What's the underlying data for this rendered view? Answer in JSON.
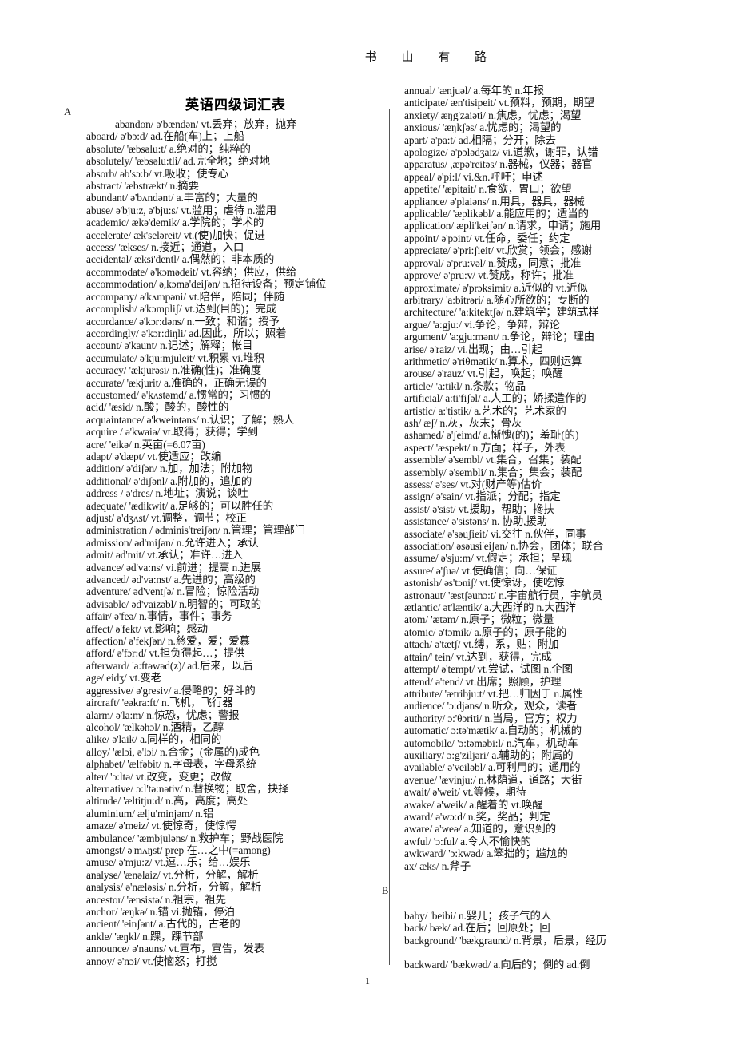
{
  "header": {
    "running_head": "书 山 有 路"
  },
  "title": "英语四级词汇表",
  "footer": {
    "page_number": "1"
  },
  "left_column": {
    "section_letter": "A",
    "entries": [
      "abandon/ ə'bændən/ vt.丢弃；放弃，抛弃",
      "aboard/ ə'bɔ:d/ ad.在船(车)上；上船",
      "absolute/ 'æbsəlu:t/ a.绝对的；纯粹的",
      "absolutely/ 'æbsəlu:tli/ ad.完全地；绝对地",
      "absorb/ əb'sɔ:b/ vt.吸收；使专心",
      "abstract/ 'æbstrækt/ n.摘要",
      "abundant/ ə'bʌndənt/ a.丰富的；大量的",
      "abuse/ ə'bju:z, ə'bju:s/ vt.滥用；虐待 n.滥用",
      "academic/ ækə'demik/ a.学院的；学术的",
      "accelerate/ æk'seləreit/ vt.(使)加快；促进",
      "access/ 'ækses/ n.接近；通道，入口",
      "accidental/ æksi'dentl/ a.偶然的；非本质的",
      "accommodate/ ə'kɔmədeit/ vt.容纳；供应，供给",
      "accommodation/ ə,kɔmə'deiʃən/ n.招待设备；预定铺位",
      "accompany/ ə'kʌmpəni/ vt.陪伴，陪同；伴随",
      "accomplish/ ə'kɔmpliʃ/ vt.达到(目的)；完成",
      "accordance/ ə'kɔr:dəns/ n.一致；和谐；授予",
      "accordingly/ ə'kɔr:diŋli/ ad.因此，所以；照着",
      "account/ ə'kaunt/ n.记述；解释；帐目",
      "accumulate/ ə'kju:mjuleit/ vt.积累 vi.堆积",
      "accuracy/ 'ækjurəsi/ n.准确(性)；准确度",
      "accurate/ 'ækjurit/ a.准确的，正确无误的",
      "accustomed/ ə'kʌstəmd/ a.惯常的；习惯的",
      "acid/ 'æsid/ n.酸；酸的，酸性的",
      "acquaintance/ ə'kweintəns/ n.认识；了解；熟人",
      "acquire / ə'kwaiə/ vt.取得；获得；学到",
      "acre/ 'eikə/ n.英亩(=6.07亩)",
      "adapt/ ə'dæpt/ vt.使适应；改编",
      "addition/ ə'diʃən/ n.加，加法；附加物",
      "additional/ ə'diʃənl/ a.附加的，追加的",
      "address / ə'dres/ n.地址；演说；谈吐",
      "adequate/ 'ædikwit/ a.足够的；可以胜任的",
      "adjust/ ə'dʒʌst/ vt.调整，调节；校正",
      "administration / ədminis'treiʃən/ n.管理；管理部门",
      "admission/ əd'miʃən/ n.允许进入；承认",
      "admit/ əd'mit/ vt.承认；准许…进入",
      "advance/ əd'va:ns/ vi.前进；提高 n.进展",
      "advanced/ əd'va:nst/ a.先进的；高级的",
      "adventure/ əd'ventʃə/ n.冒险；惊险活动",
      "advisable/ əd'vaizəbl/ n.明智的；可取的",
      "affair/ ə'feə/ n.事情，事件；事务",
      "affect/ ə'fekt/ vt.影响；感动",
      "affection/ ə'fekʃən/ n.慈爱，爱；爱慕",
      "afford/ ə'fɔr:d/ vt.担负得起…；提供",
      "afterward/ 'a:ftəwəd(z)/ ad.后来，以后",
      "age/ eidʒ/ vt.变老",
      "aggressive/ ə'gresiv/ a.侵略的；好斗的",
      "aircraft/ 'eəkra:ft/ n.飞机，飞行器",
      "alarm/ ə'la:m/ n.惊恐，忧虑；警报",
      "alcohol/ 'ælkəhɔl/ n.酒精，乙醇",
      "alike/ ə'laik/ a.同样的，相同的",
      "alloy/ 'ælɔi, ə'lɔi/ n.合金；(金属的)成色",
      "alphabet/ 'ælfəbit/ n.字母表，字母系统",
      "alter/ 'ɔ:ltə/ vt.改变，变更；改做",
      "alternative/ ɔ:l'tə:nətiv/ n.替换物；取舍，抉择",
      "altitude/ 'æltitju:d/ n.高，高度；高处",
      "aluminium/ ælju'minjəm/ n.铝",
      "amaze/ ə'meiz/ vt.使惊奇，使惊愕",
      "ambulance/ 'æmbjuləns/ n.救护车；野战医院",
      "amongst/ ə'mʌŋst/ prep 在…之中(=among)",
      "amuse/ ə'mju:z/ vt.逗…乐；给…娱乐",
      "analyse/ 'ænəlaiz/ vt.分析，分解，解析",
      "analysis/ ə'næləsis/ n.分析，分解，解析",
      "ancestor/ 'ænsistə/ n.祖宗，祖先",
      "anchor/ 'æŋkə/ n.锚 vi.抛锚，停泊",
      "ancient/ 'einʃənt/ a.古代的，古老的",
      "ankle/ 'æŋkl/ n.踝，踝节部",
      "announce/ ə'nauns/ vt.宣布，宣告，发表",
      "annoy/ ə'nɔi/ vt.使恼怒；打搅"
    ]
  },
  "right_column": {
    "entries": [
      "annual/ 'ænjuəl/ a.每年的 n.年报",
      "anticipate/ æn'tisipeit/ vt.预料，预期，期望",
      "anxiety/ æŋg'zaiəti/ n.焦虑，忧虑；渴望",
      "anxious/ 'æŋkʃəs/ a.忧虑的；渴望的",
      "apart/ ə'pa:t/ ad.相隔；分开；除去",
      "apologize/ ə'pɔlədʒaiz/ vi.道歉，谢罪，认错",
      "apparatus/ ,æpə'reitəs/ n.器械，仪器；器官",
      "appeal/ ə'pi:l/ vi.&n.呼吁；申述",
      "appetite/ 'æpitait/ n.食欲，胃口；欲望",
      "appliance/ ə'plaiəns/ n.用具，器具，器械",
      "applicable/ 'æplikəbl/ a.能应用的；适当的",
      "application/ æpli'keiʃən/ n.请求，申请；施用",
      "appoint/ ə'pɔint/ vt.任命，委任；约定",
      "appreciate/ ə'pri:ʃieit/ vt.欣赏；领会；感谢",
      "approval/ ə'pru:vəl/ n.赞成，同意；批准",
      "approve/ ə'pru:v/ vt.赞成，称许；批准",
      "approximate/ ə'prɔksimit/ a.近似的 vt.近似",
      "arbitrary/ 'a:bitrəri/ a.随心所欲的；专断的",
      "architecture/ 'a:kitektʃə/ n.建筑学；建筑式样",
      "argue/ 'a:gju:/ vi.争论，争辩，辩论",
      "argument/ 'a:gju:mənt/ n.争论，辩论；理由",
      "arise/ ə'raiz/ vi.出现；由…引起",
      "arithmetic/ ə'riθmətik/ n.算术，四则运算",
      "arouse/ ə'rauz/ vt.引起，唤起；唤醒",
      "article/ 'a:tikl/ n.条款；物品",
      "artificial/ a:ti'fiʃəl/ a.人工的；娇揉造作的",
      "artistic/ a:'tistik/ a.艺术的；艺术家的",
      "ash/ æʃ/ n.灰，灰末；骨灰",
      "ashamed/ ə'ʃeimd/ a.惭愧(的)；羞耻(的)",
      "aspect/ 'æspekt/ n.方面；样子，外表",
      "assemble/ ə'sembl/ vt.集合，召集；装配",
      "assembly/ ə'sembli/ n.集合；集会；装配",
      "assess/ ə'ses/ vt.对(财产等)估价",
      "assign/ ə'sain/ vt.指派；分配；指定",
      "assist/ ə'sist/ vt.援助，帮助；搀扶",
      "assistance/ ə'sistəns/ n. 协助,援助",
      "associate/ ə'səuʃieit/ vi.交往 n.伙伴，同事",
      "association/ əsəusi'eiʃən/ n.协会，团体；联合",
      "assume/ ə'sju:m/ vt.假定；承担；呈现",
      "assure/ ə'ʃuə/ vt.使确信；向…保证",
      "astonish/ əs'tɔniʃ/ vt.使惊讶，使吃惊",
      "astronaut/ 'æstʃəunɔ:t/ n.宇宙航行员，宇航员",
      "ætlantic/ ət'læntik/ a.大西洋的 n.大西洋",
      "atom/ 'ætəm/ n.原子；微粒；微量",
      "atomic/ ə'tɔmik/ a.原子的；原子能的",
      "attach/ ə'tætʃ/ vt.缚，系，贴；附加",
      "attain/' tein/ vt.达到，获得，完成",
      "attempt/ ə'tempt/ vt.尝试，试图 n.企图",
      "attend/ ə'tend/ vt.出席；照顾，护理",
      "attribute/ 'ætribju:t/ vt.把…归因于 n.属性",
      "audience/ 'ɔ:djəns/ n.听众，观众，读者",
      "authority/ ɔ:'θɔriti/ n.当局，官方；权力",
      "automatic/ ɔ:tə'mætik/ a.自动的；机械的",
      "automobile/ 'ɔ:təməbi:l/ n.汽车，机动车",
      "auxiliary/ ɔ:g'ziljəri/ a.辅助的；附属的",
      "available/ ə'veiləbl/ a.可利用的；通用的",
      "avenue/ 'ævinju:/ n.林荫道，道路；大街",
      "await/ ə'weit/ vt.等候，期待",
      "awake/ ə'weik/ a.醒着的 vt.唤醒",
      "award/ ə'wɔ:d/ n.奖，奖品；判定",
      "aware/ ə'weə/ a.知道的，意识到的",
      "awful/ 'ɔ:ful/ a.令人不愉快的",
      "awkward/ 'ɔ:kwəd/ a.笨拙的；尴尬的",
      "ax/ æks/ n.斧子"
    ],
    "section_letter": "B",
    "entries_b": [
      "baby/ 'beibi/ n.婴儿；孩子气的人",
      "back/ bæk/ ad.在后；回原处；回",
      "background/ 'bækgraund/ n.背景，后景，经历"
    ],
    "entries_b_tail": [
      "backward/ 'bækwəd/ a.向后的；倒的 ad.倒"
    ]
  }
}
